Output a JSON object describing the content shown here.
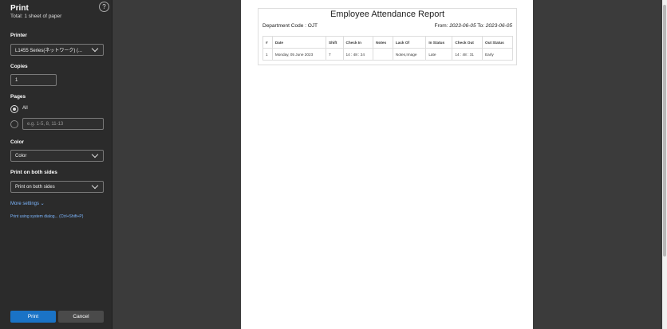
{
  "sidebar": {
    "title": "Print",
    "subtitle": "Total: 1 sheet of paper",
    "help_glyph": "?",
    "printer": {
      "label": "Printer",
      "value": "L1455 Series(ネットワーク) (..."
    },
    "copies": {
      "label": "Copies",
      "value": "1"
    },
    "pages": {
      "label": "Pages",
      "all_label": "All",
      "custom_placeholder": "e.g. 1-5, 8, 11-13"
    },
    "color": {
      "label": "Color",
      "value": "Color"
    },
    "both_sides": {
      "label": "Print on both sides",
      "value": "Print on both sides"
    },
    "more_settings": "More settings ⌄",
    "system_dialog": "Print using system dialog... (Ctrl+Shift+P)",
    "print_button": "Print",
    "cancel_button": "Cancel"
  },
  "report": {
    "title": "Employee Attendance Report",
    "department": "Department Code : OJT",
    "from_label": "From:",
    "from_date": "2023-06-05",
    "to_label": "To:",
    "to_date": "2023-06-05",
    "columns": [
      "#",
      "Date",
      "Shift",
      "Check In",
      "Notes",
      "Lack Of",
      "In Status",
      "Check Out",
      "Out Status"
    ],
    "rows": [
      [
        "1",
        "Monday, 05 June 2023",
        "7",
        "14 : 48 : 24",
        "",
        "Notes,Image",
        "Late",
        "14 : 48 : 31",
        "Early"
      ]
    ]
  },
  "colors": {
    "accent": "#1a73c6",
    "sidebar_bg": "#2b2b2b",
    "preview_bg": "#3b3b3b"
  }
}
